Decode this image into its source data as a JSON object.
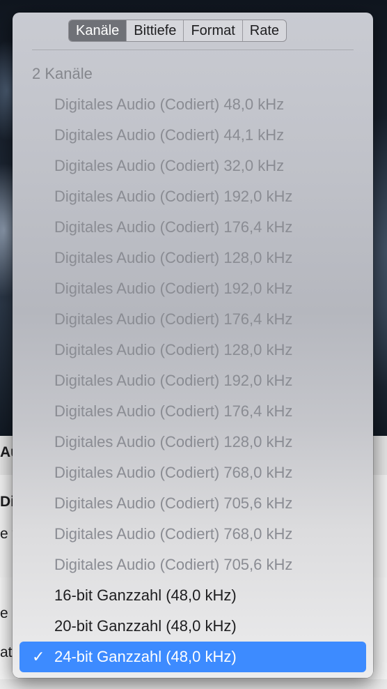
{
  "background": {
    "partial_texts": [
      "Au",
      "Di",
      "e f",
      "e",
      "at"
    ]
  },
  "menu": {
    "tabs": [
      {
        "label": "Kanäle",
        "active": true
      },
      {
        "label": "Bittiefe",
        "active": false
      },
      {
        "label": "Format",
        "active": false
      },
      {
        "label": "Rate",
        "active": false
      }
    ],
    "section_header": "2 Kanäle",
    "disabled_items": [
      "Digitales Audio (Codiert) 48,0 kHz",
      "Digitales Audio (Codiert) 44,1 kHz",
      "Digitales Audio (Codiert) 32,0 kHz",
      "Digitales Audio (Codiert) 192,0 kHz",
      "Digitales Audio (Codiert) 176,4 kHz",
      "Digitales Audio (Codiert) 128,0 kHz",
      "Digitales Audio (Codiert) 192,0 kHz",
      "Digitales Audio (Codiert) 176,4 kHz",
      "Digitales Audio (Codiert) 128,0 kHz",
      "Digitales Audio (Codiert) 192,0 kHz",
      "Digitales Audio (Codiert) 176,4 kHz",
      "Digitales Audio (Codiert) 128,0 kHz",
      "Digitales Audio (Codiert) 768,0 kHz",
      "Digitales Audio (Codiert) 705,6 kHz",
      "Digitales Audio (Codiert) 768,0 kHz",
      "Digitales Audio (Codiert) 705,6 kHz"
    ],
    "enabled_items": [
      "16-bit Ganzzahl (48,0 kHz)",
      "20-bit Ganzzahl (48,0 kHz)"
    ],
    "selected_item": "24-bit Ganzzahl (48,0 kHz)",
    "checkmark": "✓"
  },
  "colors": {
    "selection": "#3d8bff",
    "disabled_text": "#8a8c93",
    "active_tab": "#6f7177"
  }
}
